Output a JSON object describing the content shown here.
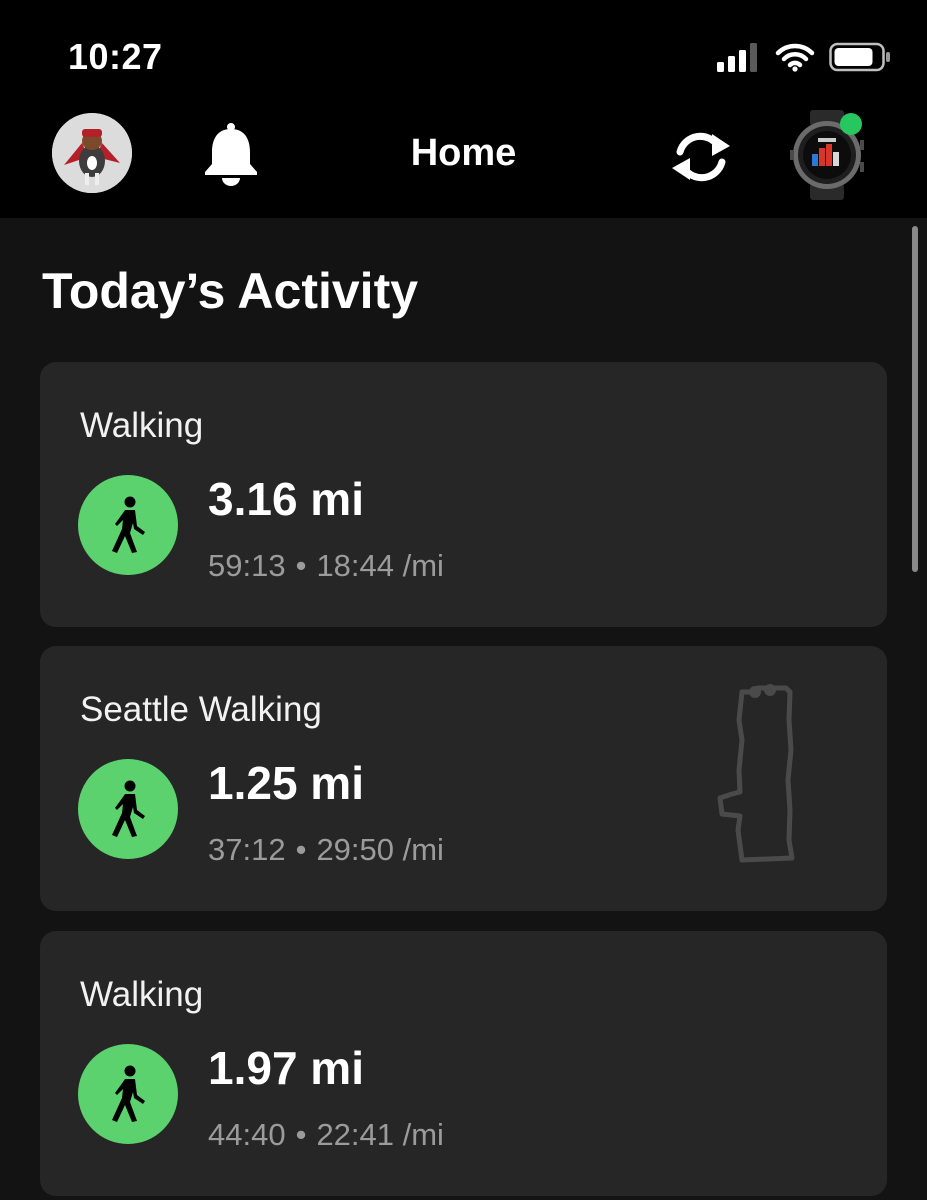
{
  "status_bar": {
    "time": "10:27",
    "icons": [
      "cellular-signal-icon",
      "wifi-icon",
      "battery-icon"
    ]
  },
  "nav": {
    "title": "Home",
    "left_icons": [
      "avatar",
      "bell-icon"
    ],
    "right_icons": [
      "sync-icon",
      "watch-device-icon"
    ],
    "device_status_color": "#27c760"
  },
  "section": {
    "title": "Today’s Activity"
  },
  "activities": [
    {
      "name": "Walking",
      "distance": "3.16 mi",
      "duration": "59:13",
      "separator": "•",
      "pace": "18:44 /mi",
      "icon": "walking-icon",
      "has_map": false
    },
    {
      "name": "Seattle Walking",
      "distance": "1.25 mi",
      "duration": "37:12",
      "separator": "•",
      "pace": "29:50 /mi",
      "icon": "walking-icon",
      "has_map": true
    },
    {
      "name": "Walking",
      "distance": "1.97 mi",
      "duration": "44:40",
      "separator": "•",
      "pace": "22:41 /mi",
      "icon": "walking-icon",
      "has_map": false
    }
  ],
  "colors": {
    "background": "#131313",
    "card": "#262626",
    "accent_green": "#5cd26e",
    "secondary_text": "#9b9b9b"
  }
}
